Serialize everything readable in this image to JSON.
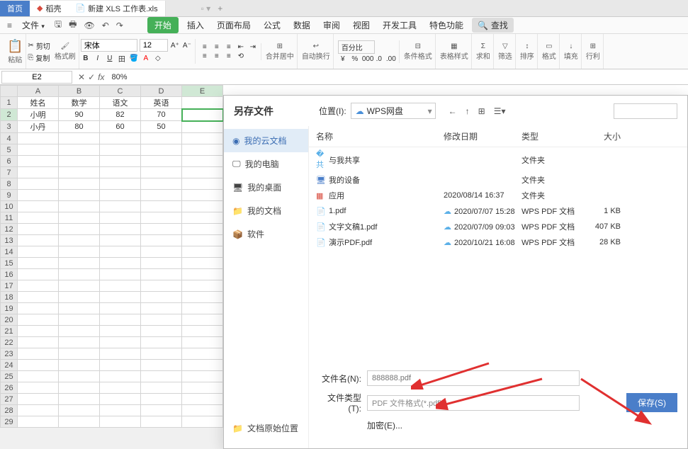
{
  "tabs": {
    "home": "首页",
    "daoke": "稻壳",
    "file": "新建 XLS 工作表.xls"
  },
  "menu": {
    "file": "文件",
    "start": "开始",
    "insert": "插入",
    "pageLayout": "页面布局",
    "formula": "公式",
    "data": "数据",
    "review": "审阅",
    "view": "视图",
    "devtools": "开发工具",
    "special": "特色功能",
    "search": "查找"
  },
  "ribbon": {
    "paste": "粘贴",
    "cut": "剪切",
    "copy": "复制",
    "formatPainter": "格式刷",
    "fontName": "宋体",
    "fontSize": "12",
    "mergeCenter": "合并居中",
    "wrap": "自动换行",
    "percent": "百分比",
    "condFormat": "条件格式",
    "tableStyle": "表格样式",
    "sum": "求和",
    "filter": "筛选",
    "sort": "排序",
    "format": "格式",
    "fill": "填充",
    "rowcol": "行利"
  },
  "formulaBar": {
    "cellRef": "E2",
    "value": "80%"
  },
  "sheet": {
    "cols": [
      "A",
      "B",
      "C",
      "D",
      "E"
    ],
    "rows": [
      [
        "姓名",
        "数学",
        "语文",
        "英语",
        ""
      ],
      [
        "小明",
        "90",
        "82",
        "70",
        ""
      ],
      [
        "小丹",
        "80",
        "60",
        "50",
        ""
      ]
    ],
    "rowCount": 29,
    "selectedCell": "E2"
  },
  "dialog": {
    "title": "另存文件",
    "locationLabel": "位置(I):",
    "locationValue": "WPS网盘",
    "sidebar": [
      {
        "icon": "cloud",
        "label": "我的云文档",
        "active": true
      },
      {
        "icon": "monitor",
        "label": "我的电脑"
      },
      {
        "icon": "desktop",
        "label": "我的桌面"
      },
      {
        "icon": "folder",
        "label": "我的文档"
      },
      {
        "icon": "soft",
        "label": "软件"
      }
    ],
    "sideFooter": "文档原始位置",
    "columns": {
      "name": "名称",
      "date": "修改日期",
      "type": "类型",
      "size": "大小"
    },
    "files": [
      {
        "icon": "share",
        "name": "与我共享",
        "date": "",
        "type": "文件夹",
        "size": ""
      },
      {
        "icon": "device",
        "name": "我的设备",
        "date": "",
        "type": "文件夹",
        "size": ""
      },
      {
        "icon": "app",
        "name": "应用",
        "date": "2020/08/14 16:37",
        "type": "文件夹",
        "size": ""
      },
      {
        "icon": "pdf",
        "name": "1.pdf",
        "date": "2020/07/07 15:28",
        "type": "WPS PDF 文档",
        "size": "1 KB",
        "sync": true
      },
      {
        "icon": "pdf",
        "name": "文字文稿1.pdf",
        "date": "2020/07/09 09:03",
        "type": "WPS PDF 文档",
        "size": "407 KB",
        "sync": true
      },
      {
        "icon": "pdf",
        "name": "演示PDF.pdf",
        "date": "2020/10/21 16:08",
        "type": "WPS PDF 文档",
        "size": "28 KB",
        "sync": true
      }
    ],
    "filenameLabel": "文件名(N):",
    "filenamePlaceholder": "888888.pdf",
    "filetypeLabel": "文件类型(T):",
    "filetypeValue": "PDF 文件格式(*.pdf)",
    "encrypt": "加密(E)...",
    "save": "保存(S)"
  }
}
